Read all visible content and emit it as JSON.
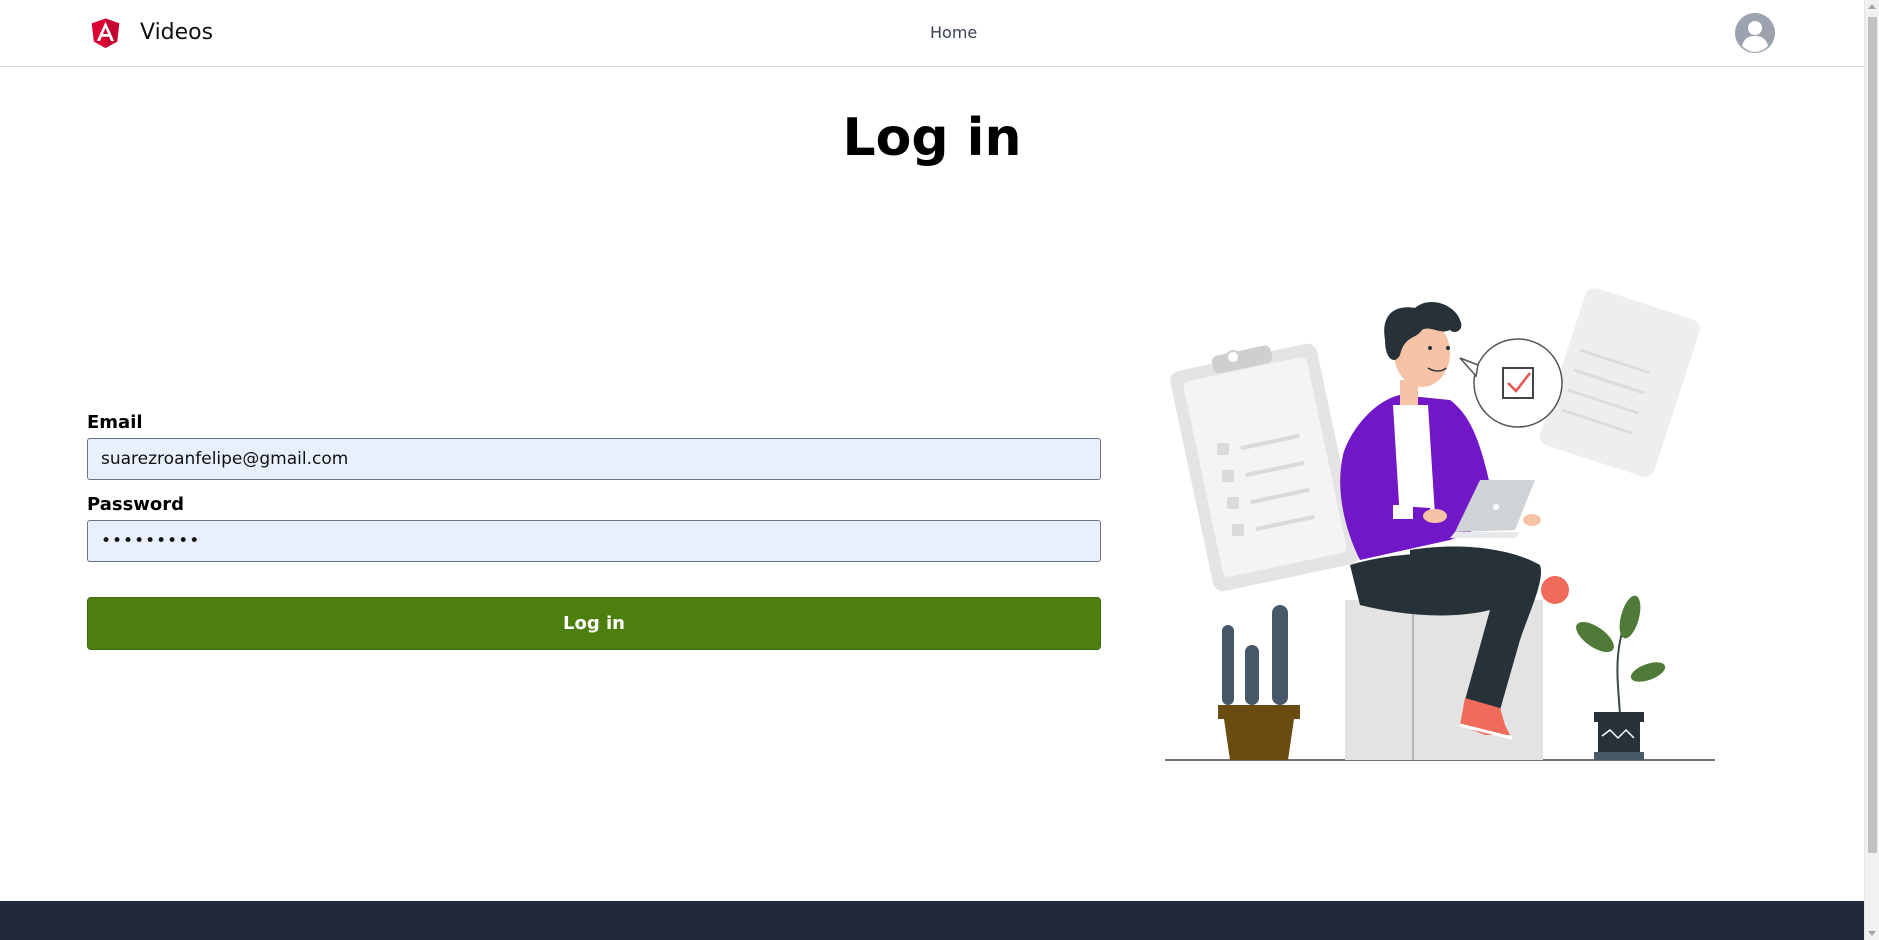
{
  "header": {
    "brand": "Videos",
    "nav_home": "Home",
    "logo_icon": "angular-logo-icon",
    "avatar_icon": "user-avatar-icon"
  },
  "main": {
    "title": "Log in",
    "form": {
      "email_label": "Email",
      "email_value": "suarezroanfelipe@gmail.com",
      "password_label": "Password",
      "password_value": "•••••••••",
      "submit_label": "Log in"
    },
    "illustration": "person-with-laptop-illustration"
  },
  "colors": {
    "accent_green": "#4d7f0f",
    "input_bg": "#e8f0fe",
    "footer_bg": "#202a3a",
    "brand_red": "#dd0031"
  }
}
